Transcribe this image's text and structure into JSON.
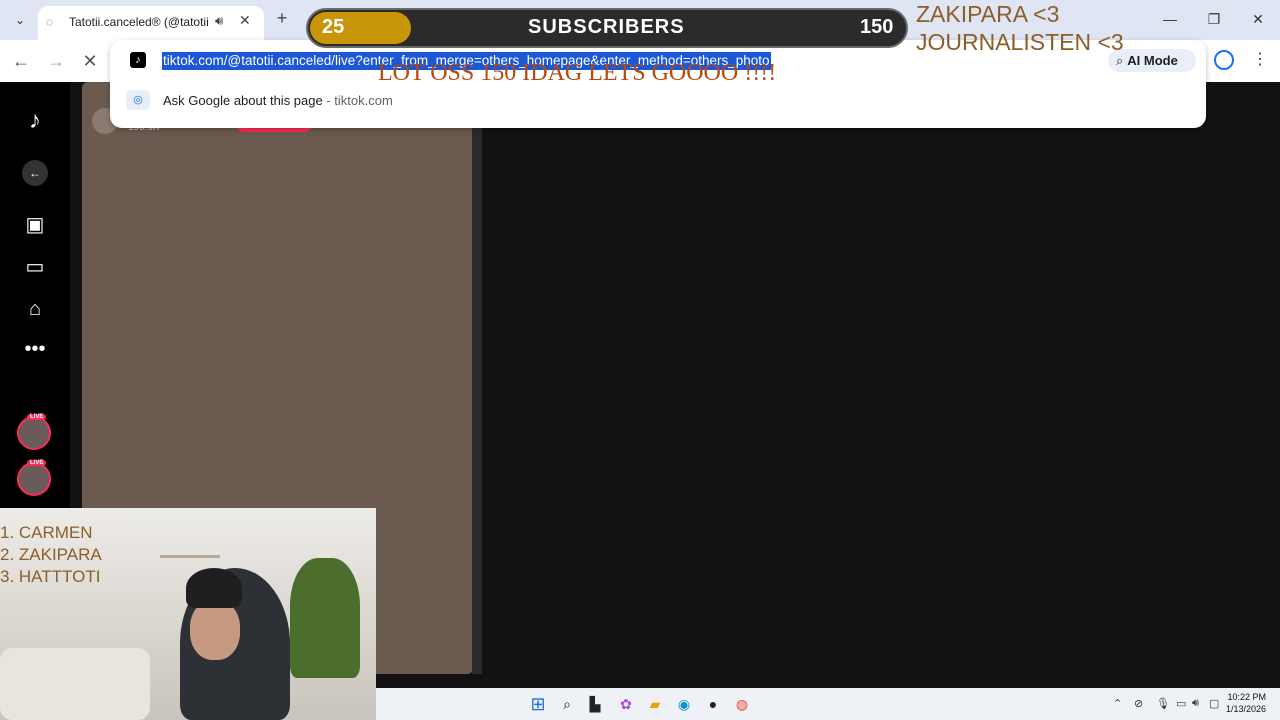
{
  "browser": {
    "tab_title": "Tatotii.canceled® (@tatotii",
    "url": "tiktok.com/@tatotii.canceled/live?enter_from_merge=others_homepage&enter_method=others_photo",
    "suggestion": {
      "text": "Ask Google about this page",
      "separator": " - ",
      "site": "tiktok.com"
    },
    "ai_mode_label": "AI Mode"
  },
  "stream_overlay": {
    "subscribers_current": "25",
    "subscribers_label": "SUBSCRIBERS",
    "subscribers_goal": "150",
    "subscribers_progress": 0.17,
    "top_right_line1": "ZAKIPARA <3",
    "top_right_line2": "JOURNALISTEN <3",
    "banner": "LOT OSS 150 IDAG LETS GOOOO !!!!",
    "leaderboard": [
      "1. CARMEN",
      "2. ZAKIPARA",
      "3. HATTTOTI"
    ]
  },
  "tiktok": {
    "viewer_count": "190.9K"
  },
  "taskbar": {
    "time": "10:22 PM",
    "date": "1/13/2026"
  },
  "colors": {
    "accent_blue": "#1c57d6",
    "tiktok_red": "#fe2c55",
    "overlay_gold": "#c9960a",
    "overlay_brown": "#8b5e2a",
    "banner_orange": "#b44a12"
  }
}
